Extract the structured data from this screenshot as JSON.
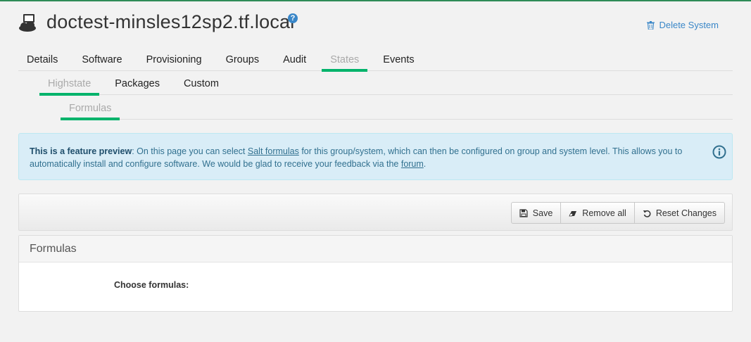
{
  "header": {
    "title": "doctest-minsles12sp2.tf.local",
    "help_icon": "?",
    "delete_label": "Delete System",
    "system_icon": "system-icon"
  },
  "tabs_primary": [
    {
      "label": "Details",
      "active": false
    },
    {
      "label": "Software",
      "active": false
    },
    {
      "label": "Provisioning",
      "active": false
    },
    {
      "label": "Groups",
      "active": false
    },
    {
      "label": "Audit",
      "active": false
    },
    {
      "label": "States",
      "active": true
    },
    {
      "label": "Events",
      "active": false
    }
  ],
  "tabs_secondary": [
    {
      "label": "Highstate",
      "active": true
    },
    {
      "label": "Packages",
      "active": false
    },
    {
      "label": "Custom",
      "active": false
    }
  ],
  "tabs_tertiary": [
    {
      "label": "Formulas",
      "active": true
    }
  ],
  "alert": {
    "bold": "This is a feature preview",
    "text1": ": On this page you can select ",
    "link1": "Salt formulas",
    "text2": " for this group/system, which can then be configured on group and system level. This allows you to automatically install and configure software. We would be glad to receive your feedback via the ",
    "link2": "forum",
    "text3": "."
  },
  "toolbar": {
    "save_label": "Save",
    "remove_all_label": "Remove all",
    "reset_label": "Reset Changes"
  },
  "panel": {
    "heading": "Formulas",
    "choose_label": "Choose formulas:"
  },
  "colors": {
    "accent": "#00b36b",
    "link": "#3a87c8",
    "alert_bg": "#d9edf7"
  }
}
